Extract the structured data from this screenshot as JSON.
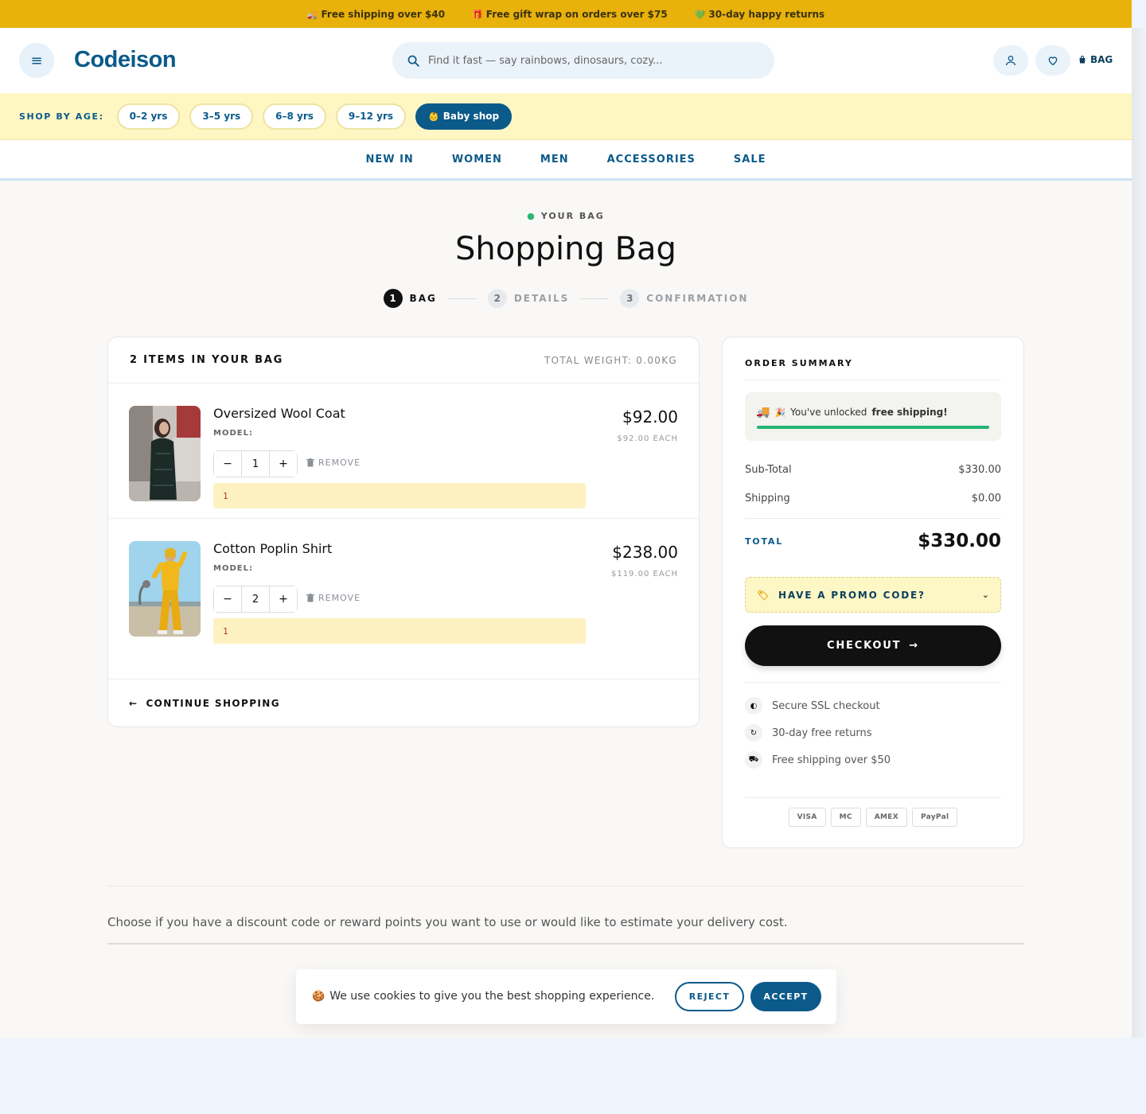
{
  "promo_bar": {
    "items": [
      {
        "icon": "truck-icon",
        "glyph": "🚚",
        "text": "Free shipping over $40"
      },
      {
        "icon": "gift-icon",
        "glyph": "🎁",
        "text": "Free gift wrap on orders over $75"
      },
      {
        "icon": "heart-icon",
        "glyph": "💚",
        "text": "30-day happy returns"
      }
    ]
  },
  "header": {
    "logo": "Codeison",
    "search_placeholder": "Find it fast — say rainbows, dinosaurs, cozy...",
    "bag_label": "BAG"
  },
  "age_bar": {
    "label": "SHOP BY AGE:",
    "pills": [
      "0–2 yrs",
      "3–5 yrs",
      "6–8 yrs",
      "9–12 yrs"
    ],
    "baby_shop": "Baby shop",
    "baby_glyph": "👶"
  },
  "nav": [
    "NEW IN",
    "WOMEN",
    "MEN",
    "ACCESSORIES",
    "SALE"
  ],
  "page": {
    "eyebrow": "YOUR BAG",
    "title": "Shopping Bag",
    "steps": [
      {
        "num": "1",
        "label": "BAG"
      },
      {
        "num": "2",
        "label": "DETAILS"
      },
      {
        "num": "3",
        "label": "CONFIRMATION"
      }
    ]
  },
  "cart": {
    "count_label": "2 ITEMS IN YOUR BAG",
    "weight_label": "TOTAL WEIGHT: 0.00KG",
    "remove_label": "REMOVE",
    "model_label": "MODEL:",
    "items": [
      {
        "name": "Oversized Wool Coat",
        "qty": "1",
        "price": "$92.00",
        "each": "$92.00 EACH",
        "note": "1"
      },
      {
        "name": "Cotton Poplin Shirt",
        "qty": "2",
        "price": "$238.00",
        "each": "$119.00 EACH",
        "note": "1"
      }
    ],
    "continue_label": "CONTINUE SHOPPING"
  },
  "summary": {
    "title": "ORDER SUMMARY",
    "shipping_msg_prefix": "You've unlocked",
    "shipping_msg_bold": "free shipping!",
    "shipping_progress_pct": 100,
    "subtotal_label": "Sub-Total",
    "subtotal_value": "$330.00",
    "shipping_label": "Shipping",
    "shipping_value": "$0.00",
    "total_label": "TOTAL",
    "total_value": "$330.00",
    "promo_label": "HAVE A PROMO CODE?",
    "checkout_label": "CHECKOUT",
    "trust": [
      "Secure SSL checkout",
      "30-day free returns",
      "Free shipping over $50"
    ],
    "cards": [
      "VISA",
      "MC",
      "AMEX",
      "PayPal"
    ]
  },
  "bottom_text": "Choose if you have a discount code or reward points you want to use or would like to estimate your delivery cost.",
  "cookie": {
    "glyph": "🍪",
    "text": "We use cookies to give you the best shopping experience.",
    "reject": "REJECT",
    "accept": "ACCEPT"
  },
  "colors": {
    "brand": "#0b5a8a",
    "promo_bar": "#e8b10b",
    "age_bar": "#fef7c4",
    "success": "#22b573"
  }
}
